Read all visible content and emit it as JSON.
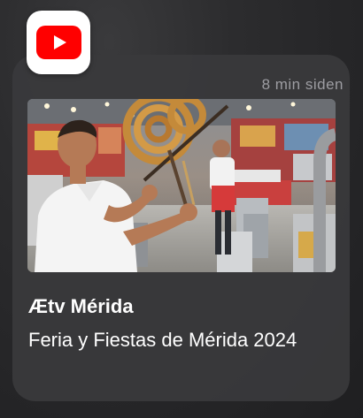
{
  "notification": {
    "app_icon": "youtube-icon",
    "timestamp": "8 min siden",
    "thumbnail_icon": "video-thumbnail",
    "channel": "Ætv Mérida",
    "title": "Feria y Fiestas de Mérida 2024"
  },
  "colors": {
    "brand_red": "#FF0000",
    "card_background": "#3A3A3C",
    "secondary_text": "#9D9DA2",
    "primary_text": "#FFFFFF"
  }
}
